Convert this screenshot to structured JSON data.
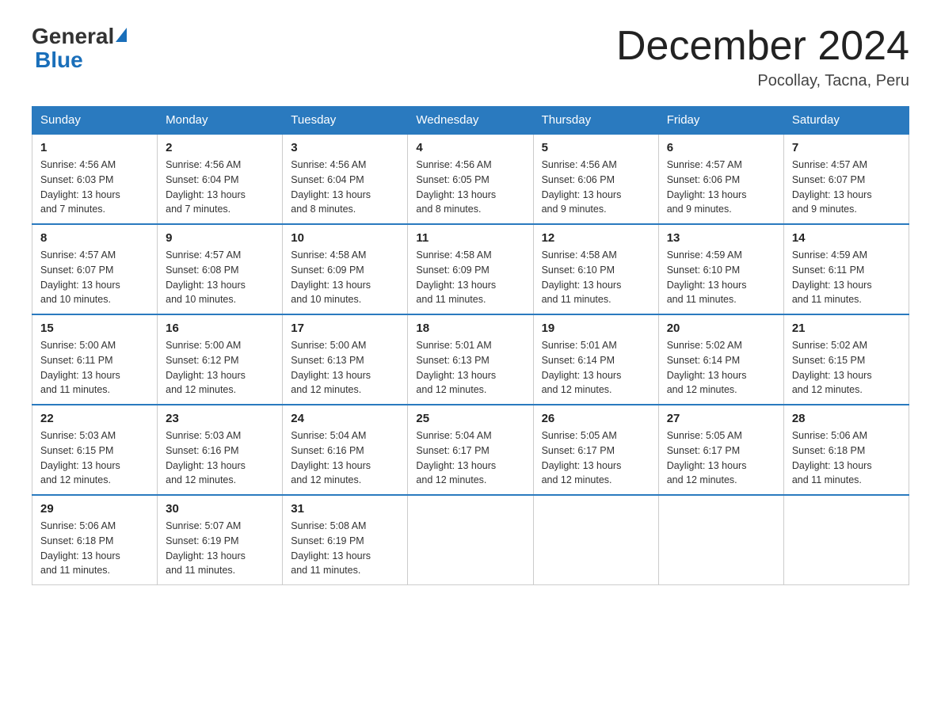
{
  "header": {
    "logo_general": "General",
    "logo_blue": "Blue",
    "month_title": "December 2024",
    "location": "Pocollay, Tacna, Peru"
  },
  "days_of_week": [
    "Sunday",
    "Monday",
    "Tuesday",
    "Wednesday",
    "Thursday",
    "Friday",
    "Saturday"
  ],
  "weeks": [
    [
      {
        "day": "1",
        "sunrise": "4:56 AM",
        "sunset": "6:03 PM",
        "daylight": "13 hours and 7 minutes."
      },
      {
        "day": "2",
        "sunrise": "4:56 AM",
        "sunset": "6:04 PM",
        "daylight": "13 hours and 7 minutes."
      },
      {
        "day": "3",
        "sunrise": "4:56 AM",
        "sunset": "6:04 PM",
        "daylight": "13 hours and 8 minutes."
      },
      {
        "day": "4",
        "sunrise": "4:56 AM",
        "sunset": "6:05 PM",
        "daylight": "13 hours and 8 minutes."
      },
      {
        "day": "5",
        "sunrise": "4:56 AM",
        "sunset": "6:06 PM",
        "daylight": "13 hours and 9 minutes."
      },
      {
        "day": "6",
        "sunrise": "4:57 AM",
        "sunset": "6:06 PM",
        "daylight": "13 hours and 9 minutes."
      },
      {
        "day": "7",
        "sunrise": "4:57 AM",
        "sunset": "6:07 PM",
        "daylight": "13 hours and 9 minutes."
      }
    ],
    [
      {
        "day": "8",
        "sunrise": "4:57 AM",
        "sunset": "6:07 PM",
        "daylight": "13 hours and 10 minutes."
      },
      {
        "day": "9",
        "sunrise": "4:57 AM",
        "sunset": "6:08 PM",
        "daylight": "13 hours and 10 minutes."
      },
      {
        "day": "10",
        "sunrise": "4:58 AM",
        "sunset": "6:09 PM",
        "daylight": "13 hours and 10 minutes."
      },
      {
        "day": "11",
        "sunrise": "4:58 AM",
        "sunset": "6:09 PM",
        "daylight": "13 hours and 11 minutes."
      },
      {
        "day": "12",
        "sunrise": "4:58 AM",
        "sunset": "6:10 PM",
        "daylight": "13 hours and 11 minutes."
      },
      {
        "day": "13",
        "sunrise": "4:59 AM",
        "sunset": "6:10 PM",
        "daylight": "13 hours and 11 minutes."
      },
      {
        "day": "14",
        "sunrise": "4:59 AM",
        "sunset": "6:11 PM",
        "daylight": "13 hours and 11 minutes."
      }
    ],
    [
      {
        "day": "15",
        "sunrise": "5:00 AM",
        "sunset": "6:11 PM",
        "daylight": "13 hours and 11 minutes."
      },
      {
        "day": "16",
        "sunrise": "5:00 AM",
        "sunset": "6:12 PM",
        "daylight": "13 hours and 12 minutes."
      },
      {
        "day": "17",
        "sunrise": "5:00 AM",
        "sunset": "6:13 PM",
        "daylight": "13 hours and 12 minutes."
      },
      {
        "day": "18",
        "sunrise": "5:01 AM",
        "sunset": "6:13 PM",
        "daylight": "13 hours and 12 minutes."
      },
      {
        "day": "19",
        "sunrise": "5:01 AM",
        "sunset": "6:14 PM",
        "daylight": "13 hours and 12 minutes."
      },
      {
        "day": "20",
        "sunrise": "5:02 AM",
        "sunset": "6:14 PM",
        "daylight": "13 hours and 12 minutes."
      },
      {
        "day": "21",
        "sunrise": "5:02 AM",
        "sunset": "6:15 PM",
        "daylight": "13 hours and 12 minutes."
      }
    ],
    [
      {
        "day": "22",
        "sunrise": "5:03 AM",
        "sunset": "6:15 PM",
        "daylight": "13 hours and 12 minutes."
      },
      {
        "day": "23",
        "sunrise": "5:03 AM",
        "sunset": "6:16 PM",
        "daylight": "13 hours and 12 minutes."
      },
      {
        "day": "24",
        "sunrise": "5:04 AM",
        "sunset": "6:16 PM",
        "daylight": "13 hours and 12 minutes."
      },
      {
        "day": "25",
        "sunrise": "5:04 AM",
        "sunset": "6:17 PM",
        "daylight": "13 hours and 12 minutes."
      },
      {
        "day": "26",
        "sunrise": "5:05 AM",
        "sunset": "6:17 PM",
        "daylight": "13 hours and 12 minutes."
      },
      {
        "day": "27",
        "sunrise": "5:05 AM",
        "sunset": "6:17 PM",
        "daylight": "13 hours and 12 minutes."
      },
      {
        "day": "28",
        "sunrise": "5:06 AM",
        "sunset": "6:18 PM",
        "daylight": "13 hours and 11 minutes."
      }
    ],
    [
      {
        "day": "29",
        "sunrise": "5:06 AM",
        "sunset": "6:18 PM",
        "daylight": "13 hours and 11 minutes."
      },
      {
        "day": "30",
        "sunrise": "5:07 AM",
        "sunset": "6:19 PM",
        "daylight": "13 hours and 11 minutes."
      },
      {
        "day": "31",
        "sunrise": "5:08 AM",
        "sunset": "6:19 PM",
        "daylight": "13 hours and 11 minutes."
      },
      null,
      null,
      null,
      null
    ]
  ],
  "labels": {
    "sunrise": "Sunrise:",
    "sunset": "Sunset:",
    "daylight": "Daylight:"
  }
}
